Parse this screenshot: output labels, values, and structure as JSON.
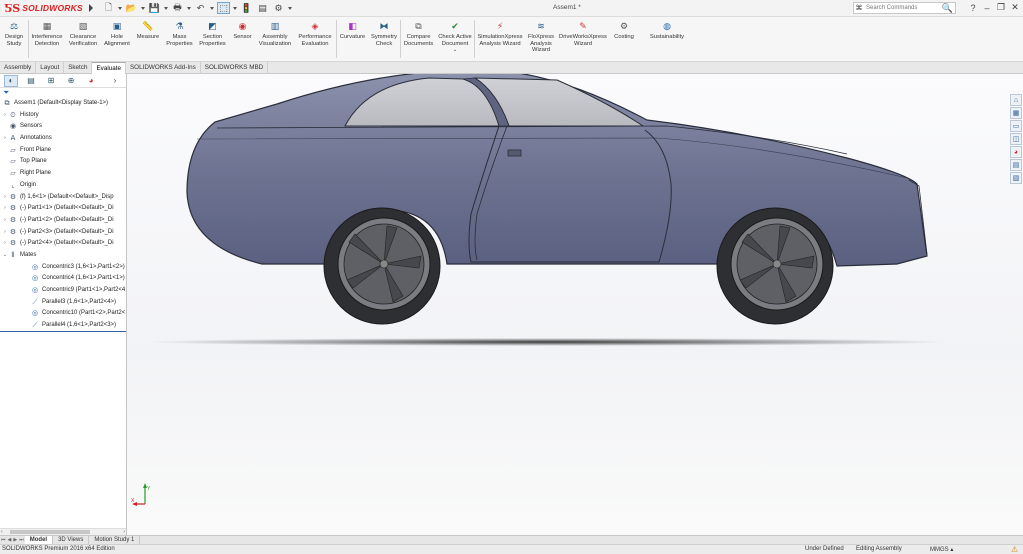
{
  "app": {
    "brand": "SOLIDWORKS",
    "doc_title": "Assem1 *"
  },
  "search": {
    "placeholder": "Search Commands"
  },
  "window_controls": [
    "?",
    "–",
    "❐",
    "✕"
  ],
  "toolbar": {
    "commands": [
      {
        "label": "Design Study",
        "icon": "design-study-icon"
      },
      {
        "label": "Interference Detection",
        "icon": "interference-icon"
      },
      {
        "label": "Clearance Verification",
        "icon": "clearance-icon"
      },
      {
        "label": "Hole Alignment",
        "icon": "hole-alignment-icon"
      },
      {
        "label": "Measure",
        "icon": "measure-icon"
      },
      {
        "label": "Mass Properties",
        "icon": "mass-properties-icon"
      },
      {
        "label": "Section Properties",
        "icon": "section-properties-icon"
      },
      {
        "label": "Sensor",
        "icon": "sensor-icon"
      },
      {
        "label": "Assembly Visualization",
        "icon": "assembly-visualization-icon"
      },
      {
        "label": "Performance Evaluation",
        "icon": "performance-icon"
      },
      {
        "label": "Curvature",
        "icon": "curvature-icon"
      },
      {
        "label": "Symmetry Check",
        "icon": "symmetry-icon"
      },
      {
        "label": "Compare Documents",
        "icon": "compare-icon"
      },
      {
        "label": "Check Active Document",
        "icon": "check-icon"
      },
      {
        "label": "SimulationXpress Analysis Wizard",
        "icon": "simulation-icon"
      },
      {
        "label": "FloXpress Analysis Wizard",
        "icon": "floxpress-icon"
      },
      {
        "label": "DriveWorksXpress Wizard",
        "icon": "driveworks-icon"
      },
      {
        "label": "Costing",
        "icon": "costing-icon"
      },
      {
        "label": "Sustainability",
        "icon": "sustainability-icon"
      }
    ]
  },
  "tabs": [
    "Assembly",
    "Layout",
    "Sketch",
    "Evaluate",
    "SOLIDWORKS Add-Ins",
    "SOLIDWORKS MBD"
  ],
  "active_tab": "Evaluate",
  "tree": [
    {
      "label": "Assem1  (Default<Display State-1>)",
      "icon": "assembly-icon",
      "exp": ""
    },
    {
      "label": "History",
      "icon": "history-icon",
      "exp": "›"
    },
    {
      "label": "Sensors",
      "icon": "sensors-icon",
      "exp": ""
    },
    {
      "label": "Annotations",
      "icon": "annotations-icon",
      "exp": "›"
    },
    {
      "label": "Front Plane",
      "icon": "plane-icon",
      "exp": ""
    },
    {
      "label": "Top Plane",
      "icon": "plane-icon",
      "exp": ""
    },
    {
      "label": "Right Plane",
      "icon": "plane-icon",
      "exp": ""
    },
    {
      "label": "Origin",
      "icon": "origin-icon",
      "exp": ""
    },
    {
      "label": "(f) 1,6<1> (Default<<Default>_Disp",
      "icon": "part-icon",
      "exp": "›"
    },
    {
      "label": "(-) Part1<1> (Default<<Default>_Di",
      "icon": "part-icon",
      "exp": "›"
    },
    {
      "label": "(-) Part1<2> (Default<<Default>_Di",
      "icon": "part-icon",
      "exp": "›"
    },
    {
      "label": "(-) Part2<3> (Default<<Default>_Di",
      "icon": "part-icon",
      "exp": "›"
    },
    {
      "label": "(-) Part2<4> (Default<<Default>_Di",
      "icon": "part-icon",
      "exp": "›"
    },
    {
      "label": "Mates",
      "icon": "mates-icon",
      "exp": "⌄"
    },
    {
      "label": "Concentric3 (1,6<1>,Part1<2>)",
      "icon": "concentric-icon",
      "exp": "",
      "indent": 1
    },
    {
      "label": "Concentric4 (1,6<1>,Part1<1>)",
      "icon": "concentric-icon",
      "exp": "",
      "indent": 1
    },
    {
      "label": "Concentric9 (Part1<1>,Part2<4",
      "icon": "concentric-icon",
      "exp": "",
      "indent": 1
    },
    {
      "label": "Parallel3 (1,6<1>,Part2<4>)",
      "icon": "parallel-icon",
      "exp": "",
      "indent": 1
    },
    {
      "label": "Concentric10 (Part1<2>,Part2<",
      "icon": "concentric-icon",
      "exp": "",
      "indent": 1
    },
    {
      "label": "Parallel4 (1,6<1>,Part2<3>)",
      "icon": "parallel-icon",
      "exp": "",
      "indent": 1
    }
  ],
  "bottom_tabs": [
    "Model",
    "3D Views",
    "Motion Study 1"
  ],
  "active_bottom_tab": "Model",
  "status": {
    "edition": "SOLIDWORKS Premium 2016 x64 Edition",
    "definition": "Under Defined",
    "mode": "Editing Assembly",
    "units": "MMGS"
  }
}
